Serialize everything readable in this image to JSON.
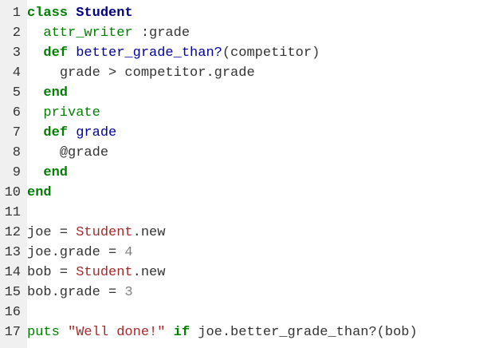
{
  "code": {
    "line_numbers": [
      "1",
      "2",
      "3",
      "4",
      "5",
      "6",
      "7",
      "8",
      "9",
      "10",
      "11",
      "12",
      "13",
      "14",
      "15",
      "16",
      "17"
    ],
    "l1": {
      "t1": "class ",
      "t2": "Student"
    },
    "l2": {
      "ind": "  ",
      "t1": "attr_writer",
      "t2": " :grade"
    },
    "l3": {
      "ind": "  ",
      "t1": "def ",
      "t2": "better_grade_than?",
      "t3": "(competitor)"
    },
    "l4": {
      "ind": "    ",
      "t1": "grade > competitor.grade"
    },
    "l5": {
      "ind": "  ",
      "t1": "end"
    },
    "l6": {
      "ind": "  ",
      "t1": "private"
    },
    "l7": {
      "ind": "  ",
      "t1": "def ",
      "t2": "grade"
    },
    "l8": {
      "ind": "    ",
      "t1": "@grade"
    },
    "l9": {
      "ind": "  ",
      "t1": "end"
    },
    "l10": {
      "t1": "end"
    },
    "l11": {
      "t1": ""
    },
    "l12": {
      "t1": "joe = ",
      "t2": "Student",
      "t3": ".new"
    },
    "l13": {
      "t1": "joe.grade = ",
      "t2": "4"
    },
    "l14": {
      "t1": "bob = ",
      "t2": "Student",
      "t3": ".new"
    },
    "l15": {
      "t1": "bob.grade = ",
      "t2": "3"
    },
    "l16": {
      "t1": ""
    },
    "l17": {
      "t1": "puts ",
      "t2": "\"Well done!\"",
      "t3": " if ",
      "t4": "joe.better_grade_than?(bob)"
    }
  },
  "colors": {
    "keyword": "#008000",
    "class_name": "#000080",
    "method_name": "#0000a0",
    "constant": "#a52a2a",
    "number": "#808080",
    "text": "#333333",
    "gutter": "#f0f0f0"
  }
}
